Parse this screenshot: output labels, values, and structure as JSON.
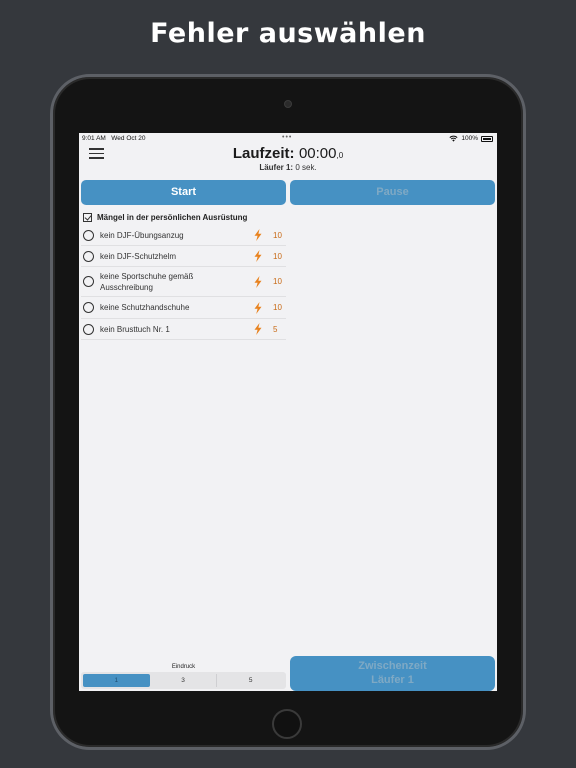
{
  "headline": "Fehler auswählen",
  "status_bar": {
    "time": "9:01 AM",
    "date": "Wed Oct 20",
    "dots": "•••",
    "battery": "100%"
  },
  "timer": {
    "label": "Laufzeit:",
    "value": "00:00",
    "fraction": ",0"
  },
  "runner": {
    "label": "Läufer 1:",
    "value": "0 sek."
  },
  "buttons": {
    "start": "Start",
    "pause": "Pause",
    "split_line1": "Zwischenzeit",
    "split_line2": "Läufer 1"
  },
  "section": {
    "title": "Mängel in der persönlichen Ausrüstung",
    "items": [
      {
        "label": "kein DJF-Übungsanzug",
        "points": "10"
      },
      {
        "label": "kein DJF-Schutzhelm",
        "points": "10"
      },
      {
        "label": "keine Sportschuhe gemäß Ausschreibung",
        "points": "10"
      },
      {
        "label": "keine Schutzhandschuhe",
        "points": "10"
      },
      {
        "label": "kein Brusttuch Nr. 1",
        "points": "5"
      }
    ]
  },
  "impression": {
    "label": "Eindruck",
    "options": [
      "1",
      "3",
      "5"
    ],
    "selected": "1"
  },
  "colors": {
    "accent": "#4691c3",
    "points": "#c86a16",
    "bolt": "#e8821e"
  }
}
